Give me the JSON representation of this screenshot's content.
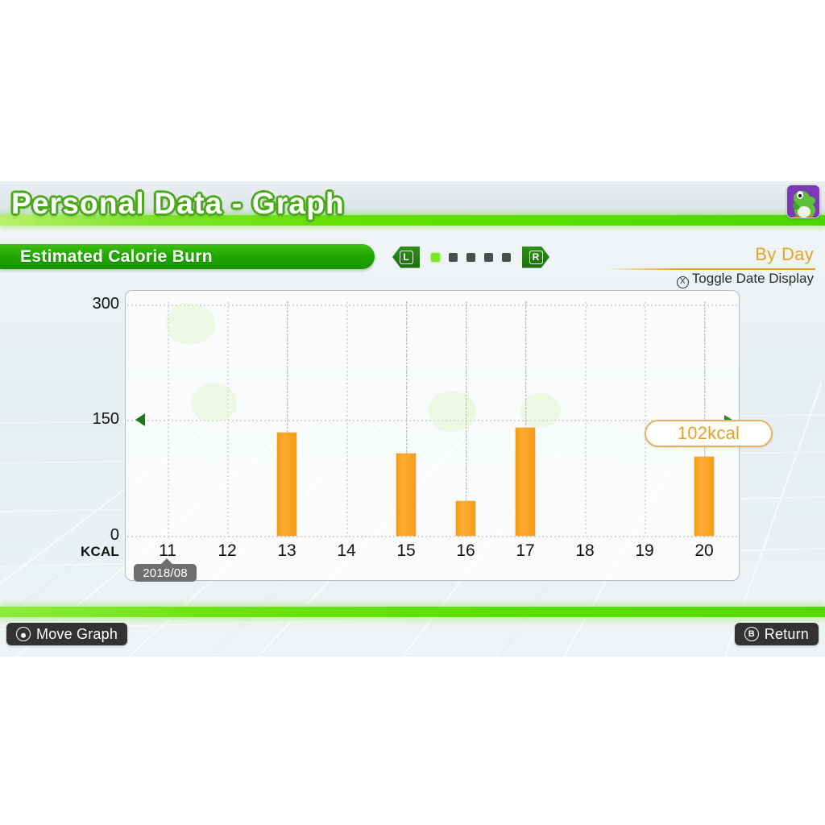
{
  "header": {
    "title": "Personal Data  - Graph",
    "avatar_icon": "yoshi-avatar"
  },
  "section": {
    "label": "Estimated Calorie Burn"
  },
  "pager": {
    "left_button": "L",
    "right_button": "R",
    "pages": 5,
    "active_page": 1
  },
  "view": {
    "mode_label": "By Day",
    "toggle_hint": "Toggle Date Display",
    "toggle_button": "X"
  },
  "tooltip": {
    "value_label": "102kcal"
  },
  "date_badge": {
    "label": "2018/08"
  },
  "footer": {
    "move_label": "Move Graph",
    "move_button": "L-stick",
    "return_label": "Return",
    "return_button": "B"
  },
  "colors": {
    "accent_green": "#21a800",
    "glow_green": "#62e000",
    "bar_orange": "#f79d19",
    "byday_orange": "#e8a321",
    "marker_green": "#1a7a17"
  },
  "chart_data": {
    "type": "bar",
    "title": "Estimated Calorie Burn",
    "xlabel": "",
    "ylabel": "KCAL",
    "ylim": [
      0,
      300
    ],
    "yticks": [
      0,
      150,
      300
    ],
    "ytick_labels": [
      "0",
      "150",
      "300"
    ],
    "grid": true,
    "legend": null,
    "unit": "kcal",
    "period_label": "2018/08",
    "categories": [
      "11",
      "12",
      "13",
      "14",
      "15",
      "16",
      "17",
      "18",
      "19",
      "20"
    ],
    "values": [
      0,
      0,
      134,
      0,
      107,
      45,
      140,
      0,
      0,
      102
    ],
    "highlight_index": 9,
    "highlight_label": "102kcal",
    "annotations": [
      {
        "type": "marker",
        "side": "left",
        "value": 150
      },
      {
        "type": "marker",
        "side": "right",
        "value": 150
      }
    ]
  }
}
